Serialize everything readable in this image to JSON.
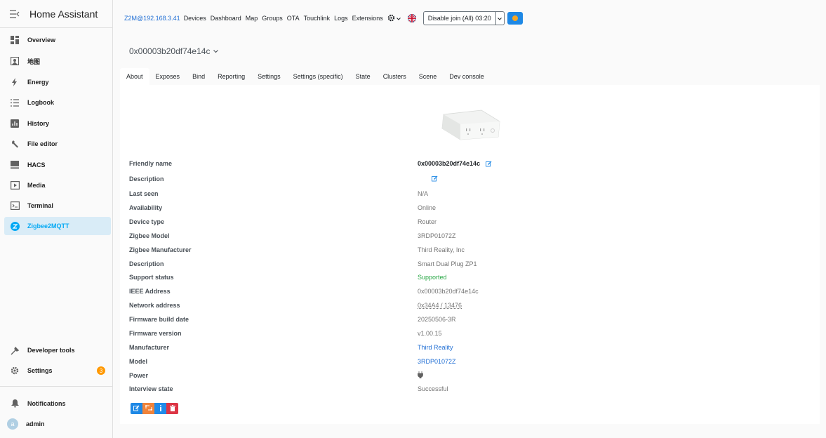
{
  "app": {
    "title": "Home Assistant"
  },
  "sidebar": {
    "items": [
      {
        "label": "Overview",
        "icon": "dashboard-icon"
      },
      {
        "label": "地图",
        "icon": "map-icon"
      },
      {
        "label": "Energy",
        "icon": "lightning-icon"
      },
      {
        "label": "Logbook",
        "icon": "list-icon"
      },
      {
        "label": "History",
        "icon": "chart-icon"
      },
      {
        "label": "File editor",
        "icon": "wrench-icon"
      },
      {
        "label": "HACS",
        "icon": "hacs-icon"
      },
      {
        "label": "Media",
        "icon": "media-icon"
      },
      {
        "label": "Terminal",
        "icon": "terminal-icon"
      },
      {
        "label": "Zigbee2MQTT",
        "icon": "zigbee-icon"
      }
    ],
    "bottom": [
      {
        "label": "Developer tools",
        "icon": "hammer-icon"
      },
      {
        "label": "Settings",
        "icon": "gear-icon",
        "badge": "3"
      }
    ],
    "notifications": {
      "label": "Notifications"
    },
    "user": {
      "label": "admin",
      "initial": "a"
    }
  },
  "topbar": {
    "brand": "Z2M@192.168.3.41",
    "links": [
      "Devices",
      "Dashboard",
      "Map",
      "Groups",
      "OTA",
      "Touchlink",
      "Logs",
      "Extensions"
    ],
    "join_button": "Disable join (All) 03:20"
  },
  "device": {
    "title": "0x00003b20df74e14c",
    "tabs": [
      "About",
      "Exposes",
      "Bind",
      "Reporting",
      "Settings",
      "Settings (specific)",
      "State",
      "Clusters",
      "Scene",
      "Dev console"
    ],
    "rows": [
      {
        "label": "Friendly name",
        "value": "0x00003b20df74e14c"
      },
      {
        "label": "Description",
        "value": ""
      },
      {
        "label": "Last seen",
        "value": "N/A"
      },
      {
        "label": "Availability",
        "value": "Online"
      },
      {
        "label": "Device type",
        "value": "Router"
      },
      {
        "label": "Zigbee Model",
        "value": "3RDP01072Z"
      },
      {
        "label": "Zigbee Manufacturer",
        "value": "Third Reality, Inc"
      },
      {
        "label": "Description",
        "value": "Smart Dual Plug ZP1"
      },
      {
        "label": "Support status",
        "value": "Supported"
      },
      {
        "label": "IEEE Address",
        "value": "0x00003b20df74e14c"
      },
      {
        "label": "Network address",
        "value": "0x34A4 / 13476"
      },
      {
        "label": "Firmware build date",
        "value": "20250506-3R"
      },
      {
        "label": "Firmware version",
        "value": "v1.00.15"
      },
      {
        "label": "Manufacturer",
        "value": "Third Reality"
      },
      {
        "label": "Model",
        "value": "3RDP01072Z"
      },
      {
        "label": "Power",
        "value": ""
      },
      {
        "label": "Interview state",
        "value": "Successful"
      }
    ]
  },
  "colors": {
    "accent": "#03a9f4",
    "link": "#1f6ed4",
    "supported": "#28a745",
    "badge": "#ff9800"
  }
}
